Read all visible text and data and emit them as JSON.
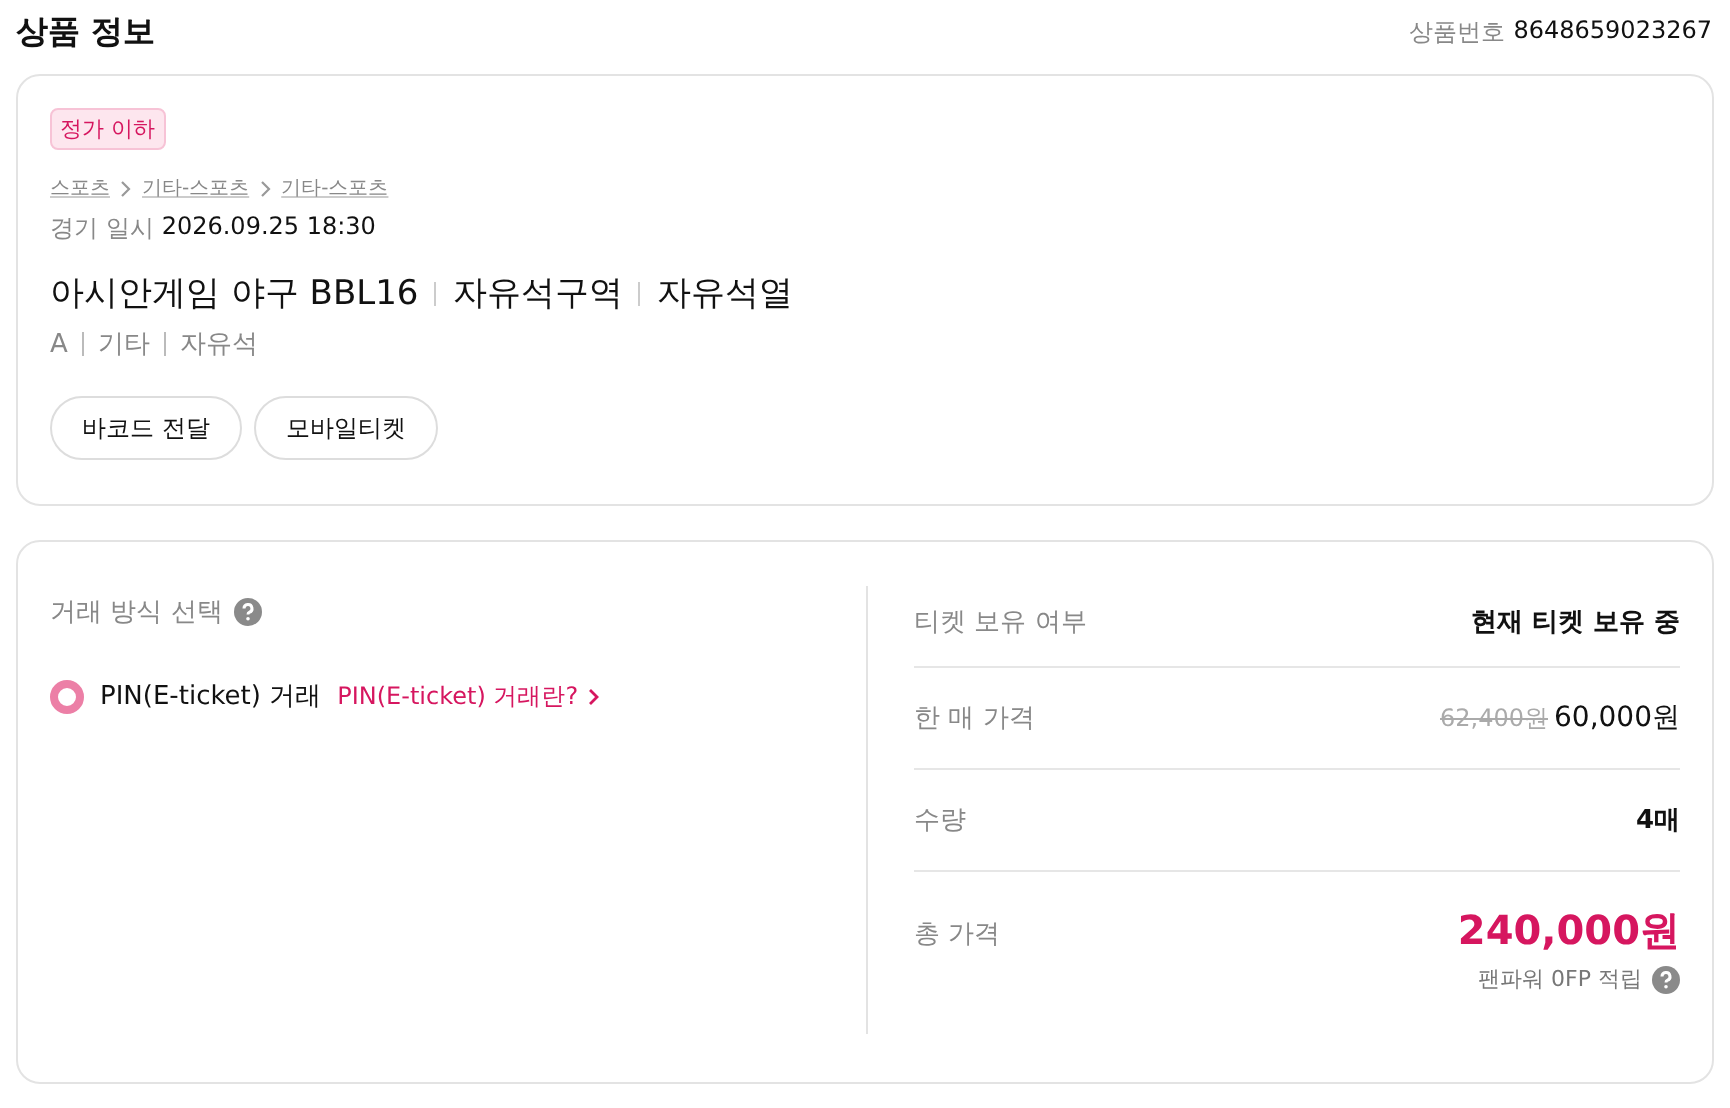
{
  "header": {
    "title": "상품 정보",
    "product_no_label": "상품번호",
    "product_no": "8648659023267"
  },
  "product": {
    "badge": "정가 이하",
    "breadcrumb": [
      "스포츠",
      "기타-스포츠",
      "기타-스포츠"
    ],
    "date_label": "경기 일시",
    "date": "2026.09.25 18:30",
    "title_parts": [
      "아시안게임 야구 BBL16",
      "자유석구역",
      "자유석열"
    ],
    "sub_parts": [
      "A",
      "기타",
      "자유석"
    ],
    "buttons": [
      "바코드 전달",
      "모바일티켓"
    ]
  },
  "trade": {
    "title": "거래 방식 선택",
    "options": [
      {
        "label": "PIN(E-ticket) 거래",
        "link": "PIN(E-ticket) 거래란?",
        "selected": true
      }
    ]
  },
  "summary": [
    {
      "kind": "text",
      "label": "티켓 보유 여부",
      "value": "현재 티켓 보유 중"
    },
    {
      "kind": "price",
      "label": "한 매 가격",
      "original": "62,400원",
      "value": "60,000원"
    },
    {
      "kind": "text",
      "label": "수량",
      "value": "4매"
    },
    {
      "kind": "total",
      "label": "총 가격",
      "value": "240,000원",
      "note": "팬파워 0FP 적립"
    }
  ]
}
